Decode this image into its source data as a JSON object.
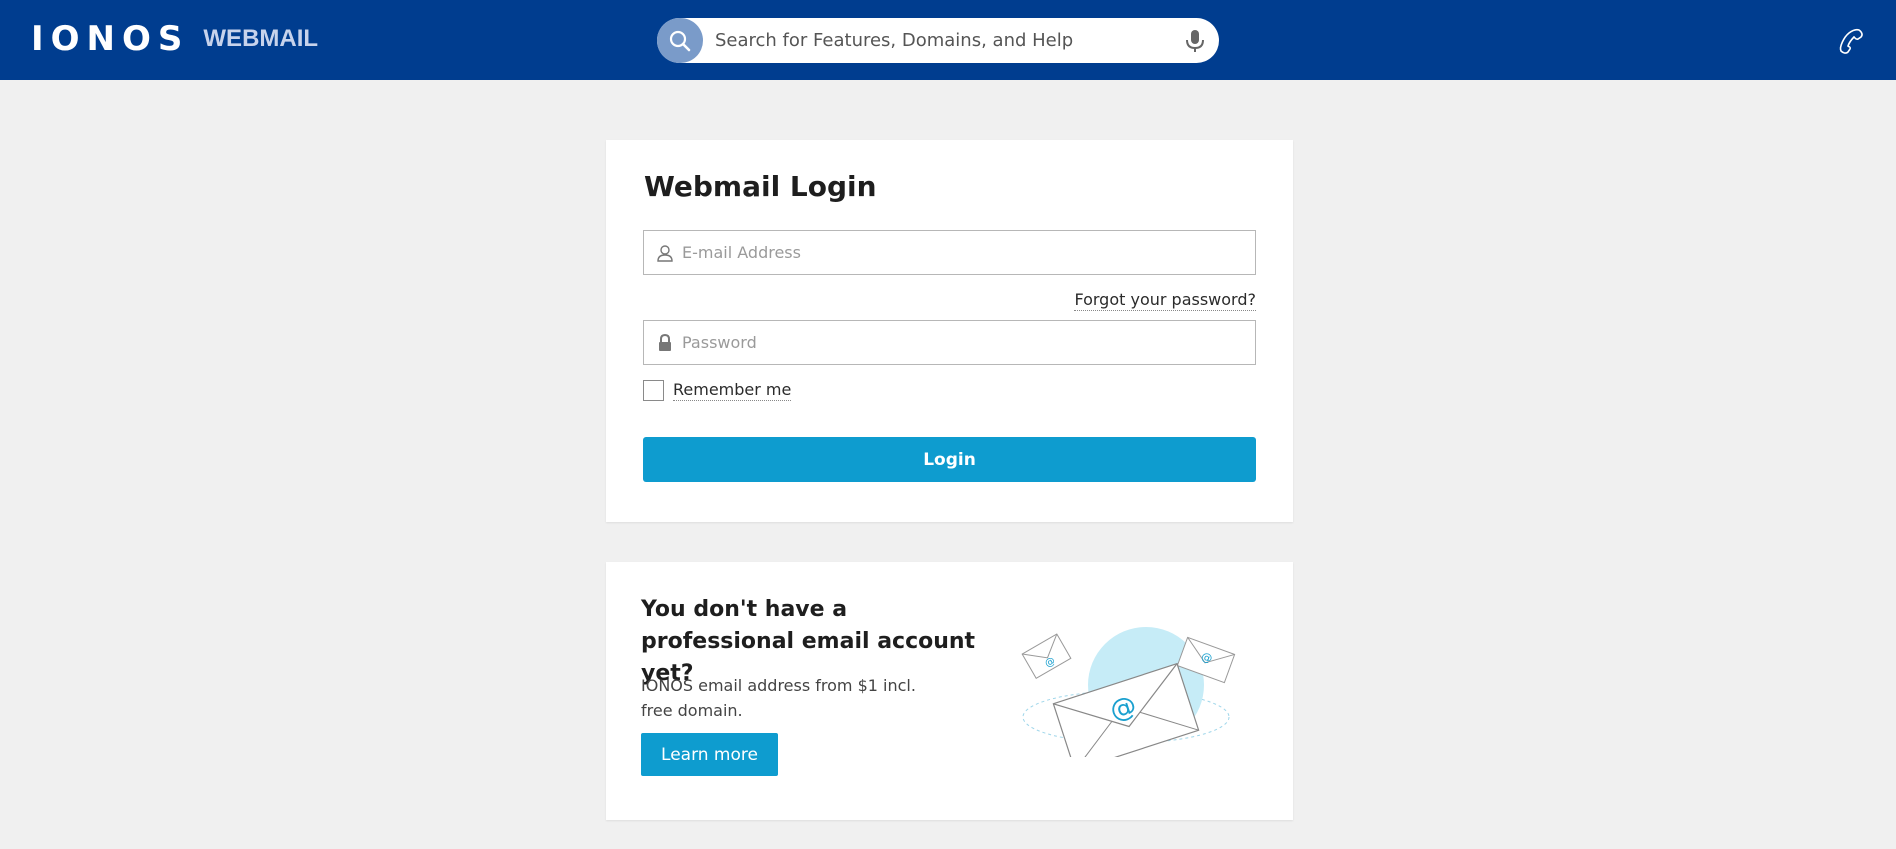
{
  "header": {
    "logo": "IONOS",
    "product": "WEBMAIL",
    "search_placeholder": "Search for Features, Domains, and Help",
    "icons": [
      "search-icon",
      "microphone-icon",
      "phone-icon"
    ]
  },
  "login": {
    "title": "Webmail Login",
    "email_placeholder": "E-mail Address",
    "email_value": "",
    "forgot_password": "Forgot your password?",
    "password_placeholder": "Password",
    "password_value": "",
    "remember_me": "Remember me",
    "remember_checked": false,
    "login_button": "Login",
    "icons": [
      "user-icon",
      "lock-icon"
    ]
  },
  "promo": {
    "title": "You don't have a professional email account yet?",
    "text": "IONOS email address from $1 incl. free domain.",
    "button": "Learn more",
    "illustration": "email-envelopes-illustration"
  },
  "colors": {
    "header_bg": "#003d8f",
    "page_bg": "#f0f0f0",
    "primary_button": "#0e9ccf",
    "search_button": "#7a9bc9"
  }
}
